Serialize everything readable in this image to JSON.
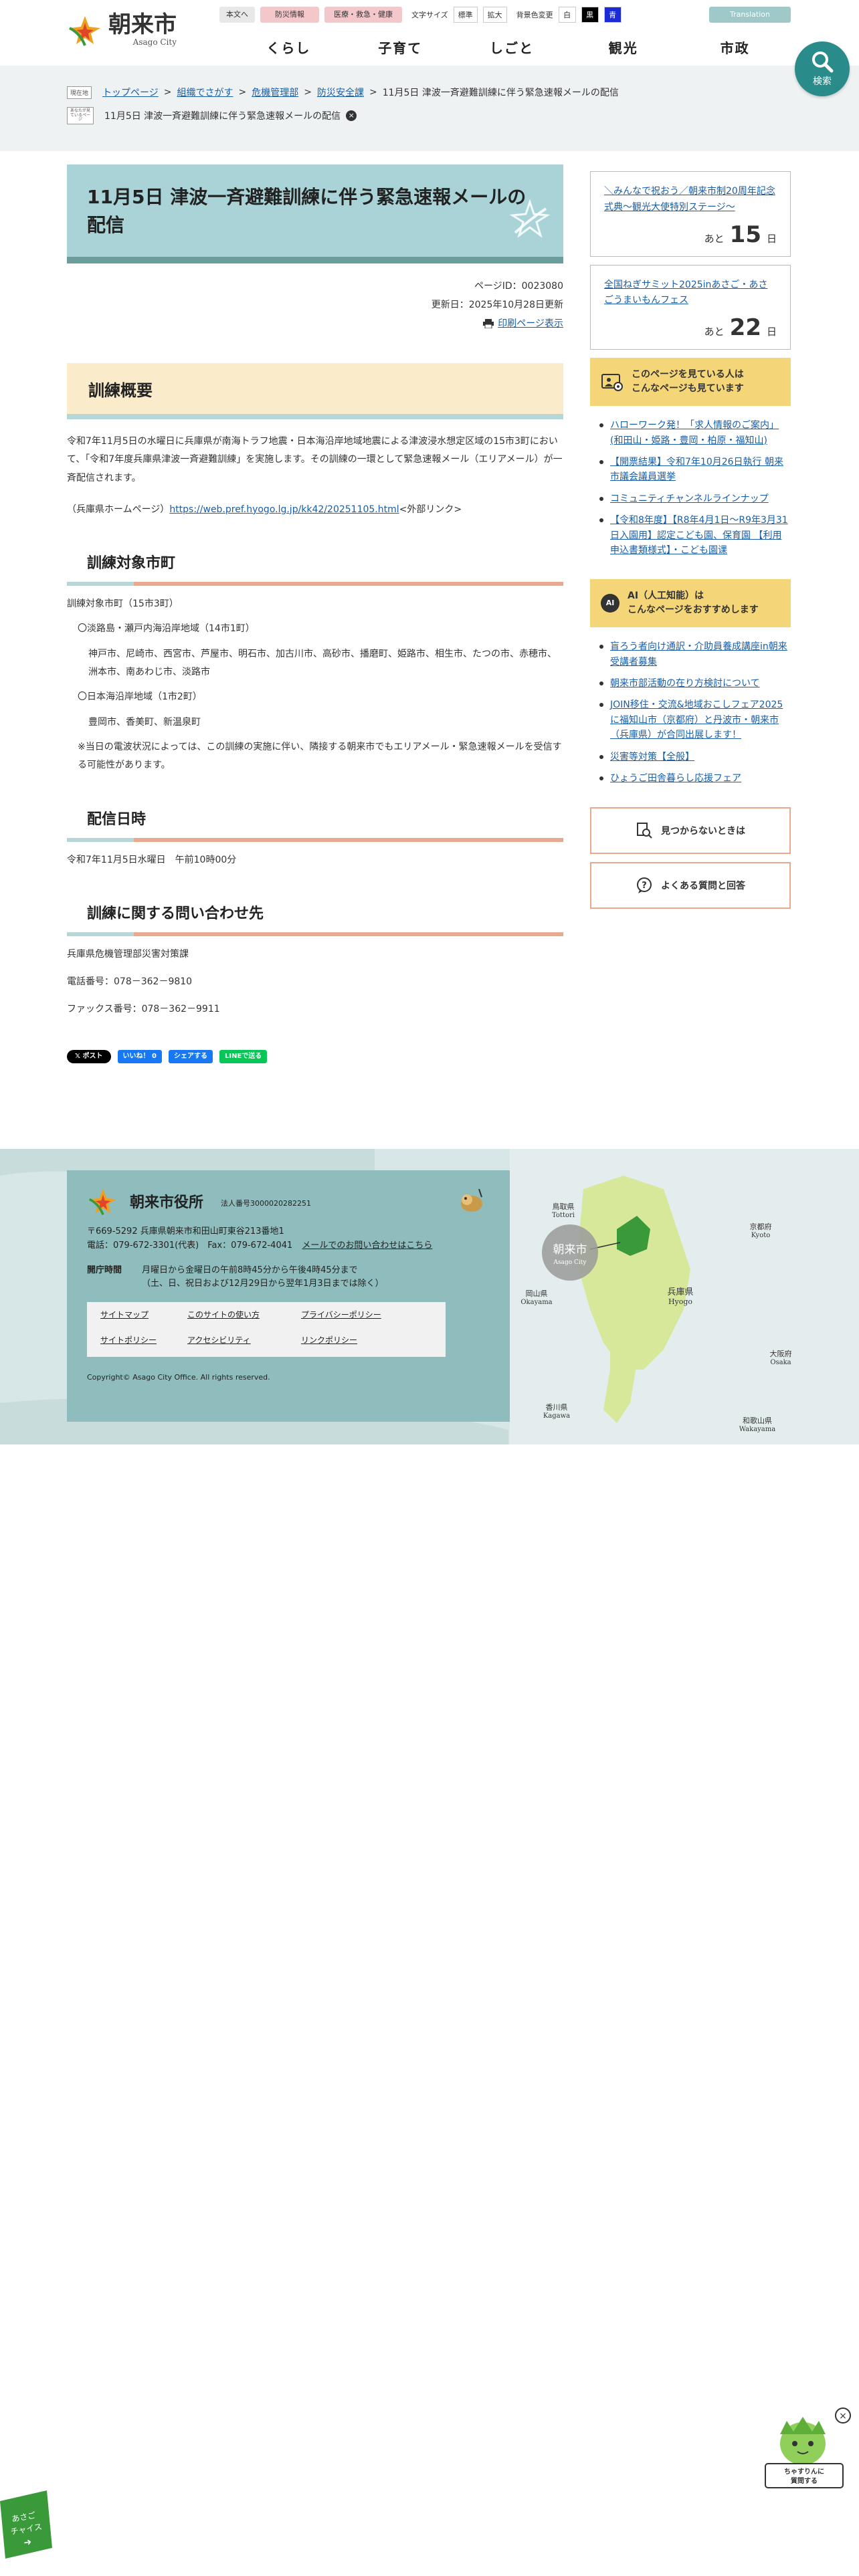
{
  "header": {
    "logo_jp": "朝来市",
    "logo_en": "Asago City",
    "skip_label": "本文へ",
    "bousai_label": "防災情報",
    "iryo_label": "医療・救急・健康",
    "font_size_label": "文字サイズ",
    "font_normal": "標準",
    "font_large": "拡大",
    "bg_label": "背景色変更",
    "bg_white": "白",
    "bg_black": "黒",
    "bg_blue": "青",
    "translation": "Translation",
    "search_label": "検索",
    "nav": [
      "くらし",
      "子育て",
      "しごと",
      "観光",
      "市政"
    ]
  },
  "breadcrumb": {
    "current_tag": "現在地",
    "recent_tag": "あなたが見ているページ",
    "items": [
      "トップページ",
      "組織でさがす",
      "危機管理部",
      "防災安全課"
    ],
    "current": "11月5日 津波一斉避難訓練に伴う緊急速報メールの配信",
    "recent": "11月5日 津波一斉避難訓練に伴う緊急速報メールの配信"
  },
  "page": {
    "title": "11月5日 津波一斉避難訓練に伴う緊急速報メールの配信",
    "page_id": "ページID：0023080",
    "updated": "更新日：2025年10月28日更新",
    "print": "印刷ページ表示",
    "h2_overview": "訓練概要",
    "overview_text": "令和7年11月5日の水曜日に兵庫県が南海トラフ地震・日本海沿岸地域地震による津波浸水想定区域の15市3町において、「令和7年度兵庫県津波一斉避難訓練」を実施します。その訓練の一環として緊急速報メール（エリアメール）が一斉配信されます。",
    "hp_prefix": "（兵庫県ホームページ）",
    "hp_link": "https://web.pref.hyogo.lg.jp/kk42/20251105.html",
    "hp_suffix": "<外部リンク>",
    "h3_target": "訓練対象市町",
    "target_count": "訓練対象市町（15市3町）",
    "area1_title": "〇淡路島・瀬戸内海沿岸地域（14市1町）",
    "area1_list": "神戸市、尼崎市、西宮市、芦屋市、明石市、加古川市、高砂市、播磨町、姫路市、相生市、たつの市、赤穂市、洲本市、南あわじ市、淡路市",
    "area2_title": "〇日本海沿岸地域（1市2町）",
    "area2_list": "豊岡市、香美町、新温泉町",
    "note": "※当日の電波状況によっては、この訓練の実施に伴い、隣接する朝来市でもエリアメール・緊急速報メールを受信する可能性があります。",
    "h3_date": "配信日時",
    "date_text": "令和7年11月5日水曜日　午前10時00分",
    "h3_contact": "訓練に関する問い合わせ先",
    "contact_org": "兵庫県危機管理部災害対策課",
    "contact_tel": "電話番号：078－362－9810",
    "contact_fax": "ファックス番号：078－362－9911"
  },
  "share": {
    "x": "ポスト",
    "fb_like": "いいね！ 0",
    "fb_share": "シェアする",
    "line": "LINEで送る"
  },
  "sidebar": {
    "events": [
      {
        "title": "＼みんなで祝おう／朝来市制20周年記念式典～観光大使特別ステージ～",
        "prefix": "あと",
        "days": "15",
        "suffix": "日"
      },
      {
        "title": "全国ねぎサミット2025inあさご・あさごうまいもんフェス",
        "prefix": "あと",
        "days": "22",
        "suffix": "日"
      }
    ],
    "viewed_head_1": "このページを見ている人は",
    "viewed_head_2": "こんなページも見ています",
    "viewed": [
      "ハローワーク発！「求人情報のご案内」(和田山・姫路・豊岡・柏原・福知山)",
      "【開票結果】令和7年10月26日執行 朝来市議会議員選挙",
      "コミュニティチャンネルラインナップ",
      "【令和8年度】【R8年4月1日～R9年3月31日入園用】認定こども園、保育園 【利用申込書類様式】・こども園课"
    ],
    "ai_badge": "AI",
    "ai_head_1": "AI（人工知能）は",
    "ai_head_2": "こんなページをおすすめします",
    "ai": [
      "盲ろう者向け通訳・介助員養成講座in朝来 受講者募集",
      "朝来市部活動の在り方検討について",
      "JOIN移住・交流&地域おこしフェア2025に福知山市（京都府）と丹波市・朝来市（兵庫県）が合同出展します！",
      "災害等対策【全般】",
      "ひょうご田舎暮らし応援フェア"
    ],
    "btn_notfound": "見つからないときは",
    "btn_faq": "よくある質問と回答"
  },
  "footer": {
    "name": "朝来市役所",
    "corp_no": "法人番号3000020282251",
    "address": "〒669-5292 兵庫県朝来市和田山町東谷213番地1",
    "tel": "電話：079-672-3301(代表)　Fax：079-672-4041",
    "mail_link": "メールでのお問い合わせはこちら",
    "hours_label": "開庁時間",
    "hours_1": "月曜日から金曜日の午前8時45分から午後4時45分まで",
    "hours_2": "（土、日、祝日および12月29日から翌年1月3日までは除く）",
    "links": [
      "サイトマップ",
      "このサイトの使い方",
      "プライバシーポリシー",
      "サイトポリシー",
      "アクセシビリティ",
      "リンクポリシー"
    ],
    "copyright": "Copyright© Asago City Office. All rights reserved.",
    "map_labels": {
      "tottori_jp": "鳥取県",
      "tottori_en": "Tottori",
      "kyoto_jp": "京都府",
      "kyoto_en": "Kyoto",
      "okayama_jp": "岡山県",
      "okayama_en": "Okayama",
      "hyogo_jp": "兵庫県",
      "hyogo_en": "Hyogo",
      "osaka_jp": "大阪府",
      "osaka_en": "Osaka",
      "kagawa_jp": "香川県",
      "kagawa_en": "Kagawa",
      "wakayama_jp": "和歌山県",
      "wakayama_en": "Wakayama",
      "asago_jp": "朝来市",
      "asago_en": "Asago City"
    }
  },
  "floating": {
    "mascot_text_1": "ちゃすりんに",
    "mascot_text_2": "質問する",
    "left_badge_1": "あさご",
    "left_badge_2": "チャイス"
  },
  "colors": {
    "title_bg": "#a9d3d7",
    "h2_bg": "#faeccb",
    "accent_teal": "#2a8c8a",
    "accent_orange": "#e8a98e",
    "side_head": "#f4d577",
    "footer_box": "#8fbcbc"
  }
}
